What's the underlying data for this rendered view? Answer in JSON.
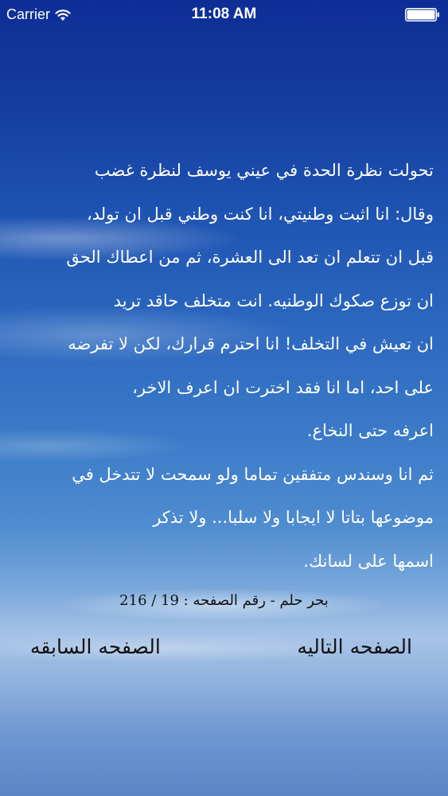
{
  "status_bar": {
    "carrier": "Carrier",
    "time": "11:08 AM"
  },
  "story": {
    "lines": [
      "تحولت نظرة الحدة في عيني يوسف لنظرة غضب",
      "وقال: انا اثبت وطنيتي، انا كنت وطني قبل ان تولد،",
      "قبل ان تتعلم ان تعد الى العشرة، ثم من اعطاك الحق",
      "ان توزع صكوك الوطنيه. انت متخلف حاقد تريد",
      "ان تعيش في التخلف! انا احترم قرارك، لكن لا تفرضه",
      "على احد، اما انا فقد اخترت ان اعرف الاخر،",
      "اعرفه حتى النخاع.",
      "ثم انا وسندس متفقين تماما ولو سمحت لا تتدخل في",
      "موضوعها بتاتا لا ايجابا ولا سلبا... ولا تذكر",
      "اسمها على لسانك."
    ]
  },
  "footer": {
    "page_info": "بحر حلم - رقم الصفحه : 19 / 216",
    "next_page": "الصفحه التاليه",
    "previous_page": "الصفحه السابقه"
  },
  "colors": {
    "sky_top": "#0d2e96",
    "sky_horizon": "#a7c3e6",
    "text": "#ffffff",
    "footer_text": "#111111"
  }
}
